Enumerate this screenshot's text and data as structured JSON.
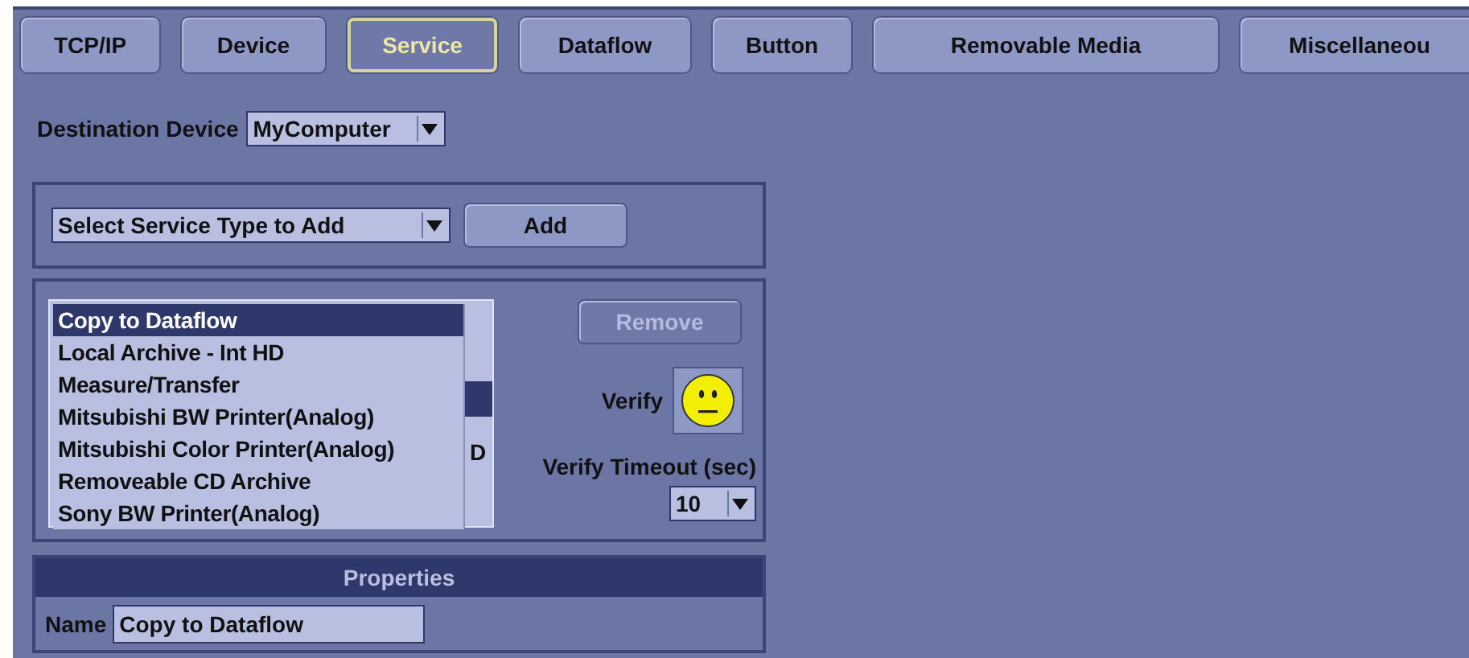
{
  "tabs": [
    {
      "label": "TCP/IP",
      "selected": false
    },
    {
      "label": "Device",
      "selected": false
    },
    {
      "label": "Service",
      "selected": true
    },
    {
      "label": "Dataflow",
      "selected": false
    },
    {
      "label": "Button",
      "selected": false
    },
    {
      "label": "Removable Media",
      "selected": false
    },
    {
      "label": "Miscellaneou",
      "selected": false
    }
  ],
  "destination_device": {
    "label": "Destination Device",
    "value": "MyComputer"
  },
  "service_type": {
    "placeholder": "Select Service Type to Add",
    "button": "Add"
  },
  "service_list": {
    "covered_text": "D"
  },
  "service_dropdown": [
    {
      "label": "Copy to Dataflow",
      "selected": true
    },
    {
      "label": "Local Archive - Int HD",
      "selected": false
    },
    {
      "label": "Measure/Transfer",
      "selected": false
    },
    {
      "label": "Mitsubishi BW Printer(Analog)",
      "selected": false
    },
    {
      "label": "Mitsubishi Color Printer(Analog)",
      "selected": false
    },
    {
      "label": "Removeable CD Archive",
      "selected": false
    },
    {
      "label": "Sony BW Printer(Analog)",
      "selected": false
    }
  ],
  "remove_button": {
    "label": "Remove",
    "disabled": true
  },
  "verify": {
    "label": "Verify"
  },
  "verify_timeout": {
    "label": "Verify Timeout (sec)",
    "value": "10"
  },
  "properties": {
    "title": "Properties",
    "name_label": "Name",
    "name_value": "Copy to Dataflow"
  }
}
